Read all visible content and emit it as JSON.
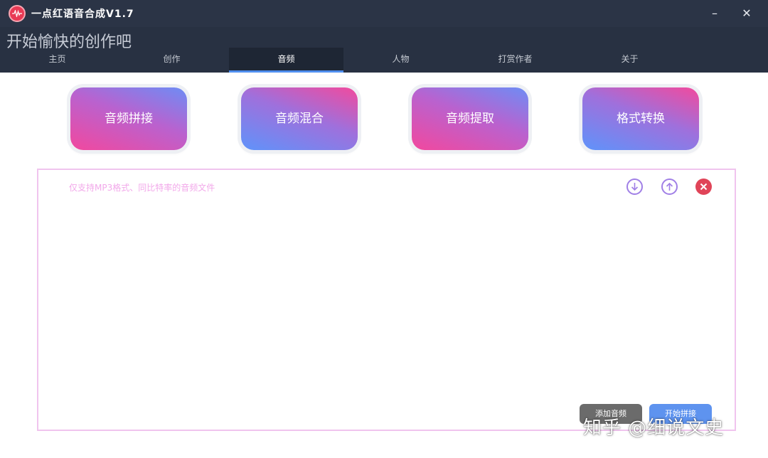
{
  "window": {
    "title": "一点红语音合成V1.7",
    "minimize_glyph": "–",
    "close_glyph": "✕",
    "logo_icon": "audio-wave-icon"
  },
  "header": {
    "slogan": "开始愉快的创作吧"
  },
  "tabs": [
    {
      "label": "主页",
      "active": false
    },
    {
      "label": "创作",
      "active": false
    },
    {
      "label": "音频",
      "active": true
    },
    {
      "label": "人物",
      "active": false
    },
    {
      "label": "打赏作者",
      "active": false
    },
    {
      "label": "关于",
      "active": false
    }
  ],
  "features": [
    {
      "label": "音频拼接"
    },
    {
      "label": "音频混合"
    },
    {
      "label": "音频提取"
    },
    {
      "label": "格式转换"
    }
  ],
  "panel": {
    "hint": "仅支持MP3格式、同比特率的音频文件",
    "icons": [
      "move-down-icon",
      "move-up-icon",
      "delete-icon"
    ],
    "add_label": "添加音频",
    "start_label": "开始拼接"
  },
  "watermark": "知乎 @细说文史",
  "colors": {
    "titlebar": "#2b3446",
    "tab_active_indicator": "#4f8fef",
    "panel_border": "#f0c4ee",
    "hint_text": "#f2a8ea",
    "delete": "#e04458",
    "add_button": "#6b6b6b",
    "start_button": "#5e93ef"
  }
}
